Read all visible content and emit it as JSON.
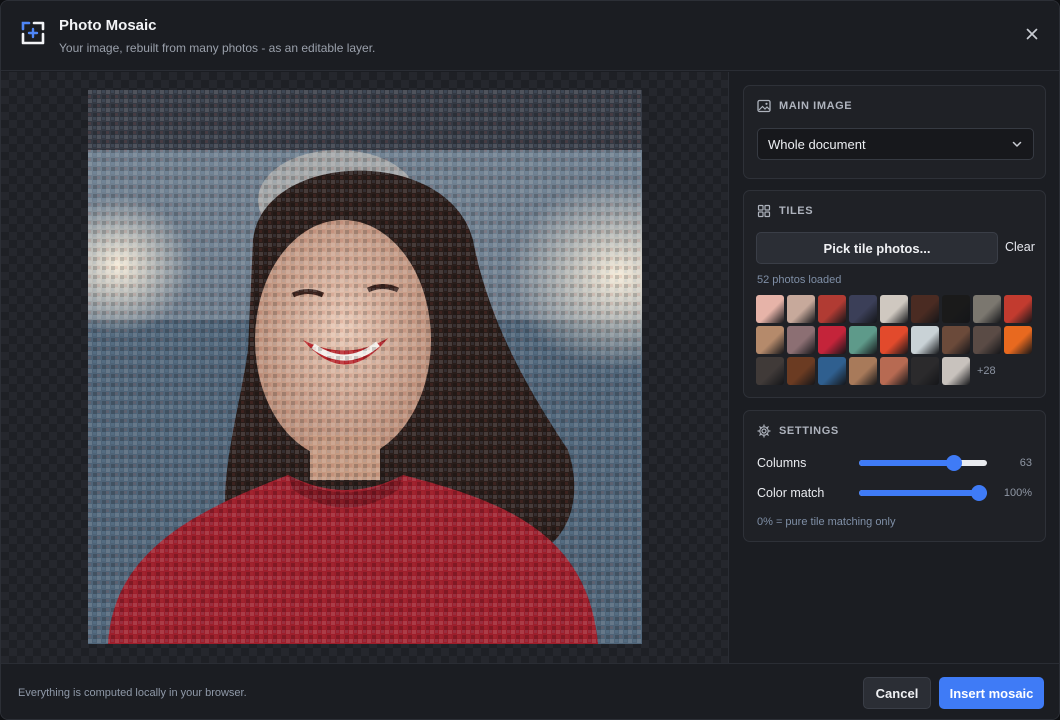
{
  "header": {
    "title": "Photo Mosaic",
    "subtitle": "Your image, rebuilt from many photos - as an editable layer.",
    "close_icon": "close-icon",
    "logo_icon": "mosaic-logo-icon"
  },
  "canvas": {
    "preview": "mosaic-preview",
    "subject": "smiling woman in red sweater"
  },
  "main_image": {
    "heading": "MAIN IMAGE",
    "icon": "image-icon",
    "selected": "Whole document"
  },
  "tiles": {
    "heading": "TILES",
    "icon": "grid-icon",
    "pick_label": "Pick tile photos...",
    "clear_label": "Clear",
    "loaded_text": "52 photos loaded",
    "more_text": "+28",
    "thumb_colors": [
      "#e6b3a8",
      "#c7a99b",
      "#b13b33",
      "#3b3f58",
      "#cfc8c0",
      "#4a2b22",
      "#1a1a1a",
      "#7b776f",
      "#c23b2f",
      "#b58a6b",
      "#8c6f73",
      "#c4243a",
      "#5e9a8a",
      "#e24a2c",
      "#c9d2d6",
      "#6b4a3a",
      "#5a4b45",
      "#e8691f",
      "#403a38",
      "#6b3b22",
      "#2f5f8f",
      "#a87a5a",
      "#b76a52",
      "#2b2a2c",
      "#c8c2bd"
    ]
  },
  "settings": {
    "heading": "SETTINGS",
    "icon": "gear-icon",
    "columns_label": "Columns",
    "columns_value": "63",
    "columns_fraction": 0.78,
    "color_match_label": "Color match",
    "color_match_value": "100%",
    "color_match_fraction": 1.0,
    "hint": "0% = pure tile matching only"
  },
  "footer": {
    "note": "Everything is computed locally in your browser.",
    "cancel_label": "Cancel",
    "insert_label": "Insert mosaic"
  },
  "colors": {
    "accent": "#3f7bf6",
    "background": "#1b1d22",
    "card": "#1f2126"
  }
}
